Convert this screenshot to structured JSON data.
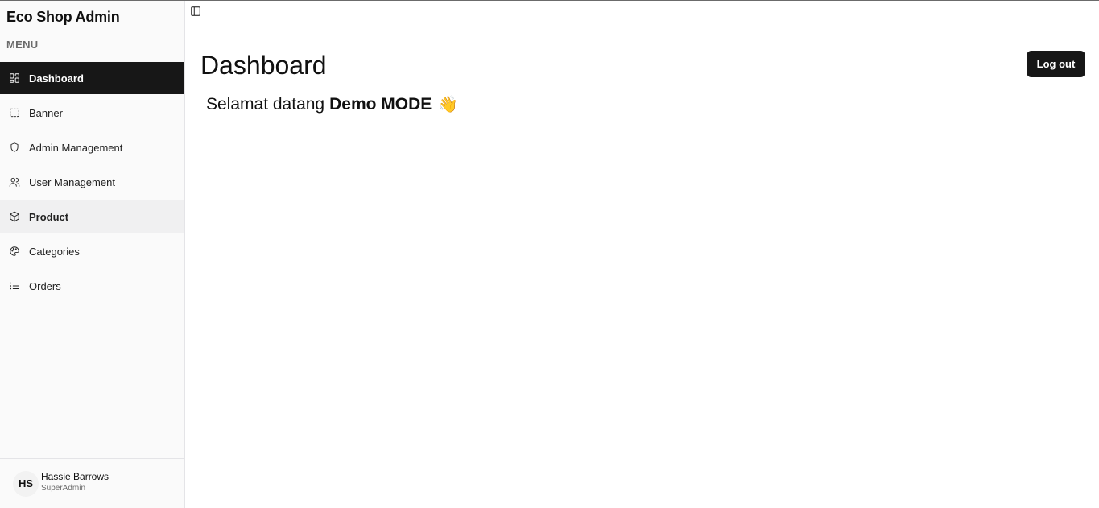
{
  "sidebar": {
    "brand": "Eco Shop Admin",
    "menu_label": "MENU",
    "items": [
      {
        "label": "Dashboard",
        "icon": "dashboard-icon"
      },
      {
        "label": "Banner",
        "icon": "banner-icon"
      },
      {
        "label": "Admin Management",
        "icon": "shield-icon"
      },
      {
        "label": "User Management",
        "icon": "users-icon"
      },
      {
        "label": "Product",
        "icon": "package-icon"
      },
      {
        "label": "Categories",
        "icon": "palette-icon"
      },
      {
        "label": "Orders",
        "icon": "list-icon"
      }
    ],
    "active_item": "Dashboard",
    "user": {
      "initials": "HS",
      "name": "Hassie Barrows",
      "role": "SuperAdmin"
    }
  },
  "header": {
    "toggle_icon": "sidebar-toggle-icon",
    "title": "Dashboard",
    "logout_label": "Log out"
  },
  "main": {
    "welcome_prefix": "Selamat datang",
    "welcome_name": "Demo MODE",
    "welcome_emoji": "👋"
  },
  "colors": {
    "active_bg": "#171717",
    "sidebar_bg": "#fafafa",
    "button_bg": "#171717"
  }
}
